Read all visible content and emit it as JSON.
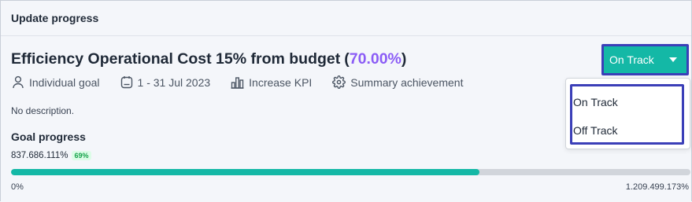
{
  "panel": {
    "title": "Update progress"
  },
  "goal": {
    "title": "Efficiency Operational Cost 15% from budget",
    "open_paren": "(",
    "percent": "70.00%",
    "close_paren": ")",
    "accent_color": "#8b5cf6"
  },
  "meta": {
    "type": {
      "icon": "person-icon",
      "label": "Individual goal"
    },
    "period": {
      "icon": "calendar-icon",
      "label": "1 - 31 Jul 2023"
    },
    "kpi": {
      "icon": "bar-chart-icon",
      "label": "Increase KPI"
    },
    "achievement": {
      "icon": "gear-icon",
      "label": "Summary achievement"
    }
  },
  "description": "No description.",
  "progress": {
    "title": "Goal progress",
    "current_value": "837.686.111%",
    "badge": "69%",
    "fraction": 0.69,
    "min_label": "0%",
    "max_label": "1.209.499.173%",
    "fill_color": "#14b8a6",
    "track_color": "#d1d5db"
  },
  "status": {
    "selected": "On Track",
    "options": [
      "On Track",
      "Off Track"
    ],
    "color": "#14b8a6",
    "highlight_color": "#3b3fb8"
  }
}
